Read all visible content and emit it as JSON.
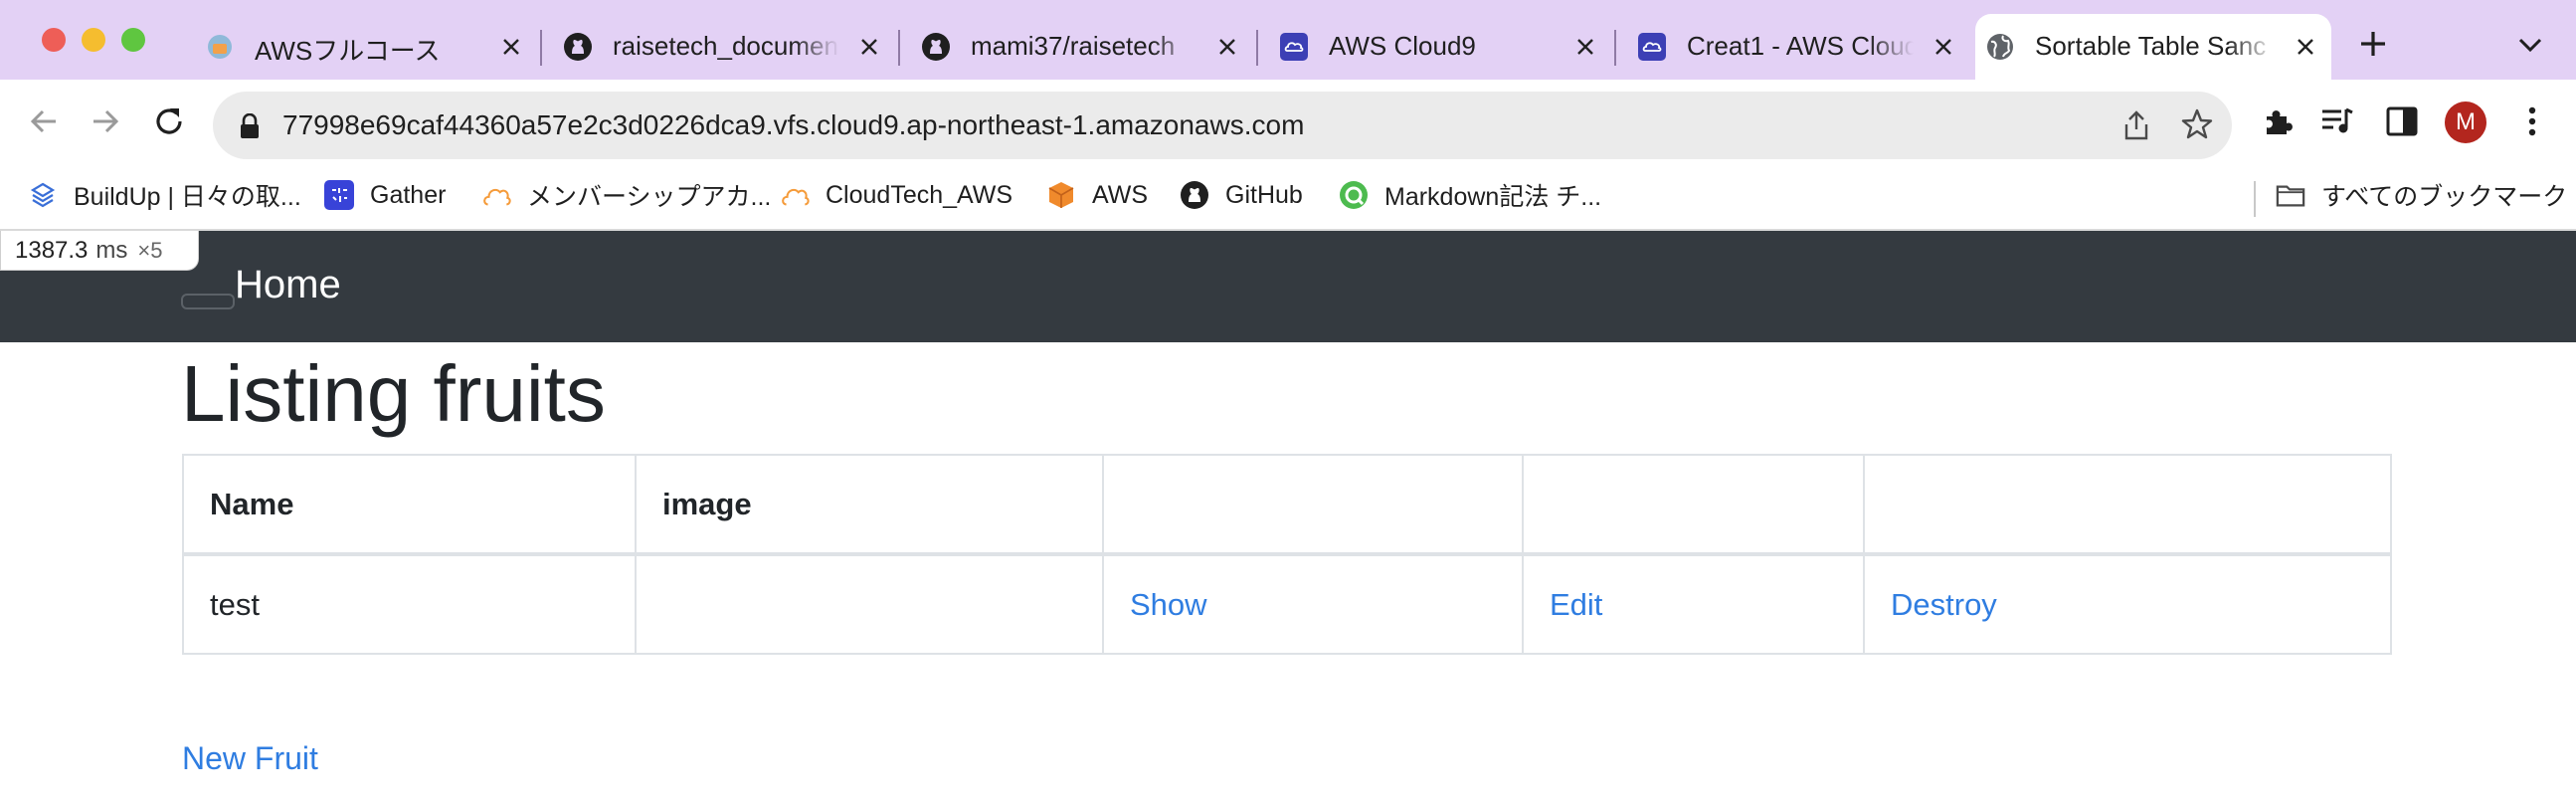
{
  "browser": {
    "tabs": [
      {
        "title": "AWSフルコース",
        "favicon": "aws-course-icon"
      },
      {
        "title": "raisetech_documen",
        "favicon": "github-icon"
      },
      {
        "title": "mami37/raisetech",
        "favicon": "github-icon"
      },
      {
        "title": "AWS Cloud9",
        "favicon": "cloud9-icon"
      },
      {
        "title": "Creat1 - AWS Cloud",
        "favicon": "cloud9-icon"
      },
      {
        "title": "Sortable Table Sanc",
        "favicon": "globe-icon",
        "active": true
      }
    ],
    "url": "77998e69caf44360a57e2c3d0226dca9.vfs.cloud9.ap-northeast-1.amazonaws.com",
    "avatar_letter": "M",
    "bookmarks": [
      {
        "label": "BuildUp | 日々の取...",
        "icon": "buildup-icon"
      },
      {
        "label": "Gather",
        "icon": "gather-icon"
      },
      {
        "label": "メンバーシップアカ...",
        "icon": "cloud-outline-icon"
      },
      {
        "label": "CloudTech_AWS",
        "icon": "cloud-outline-icon"
      },
      {
        "label": "AWS",
        "icon": "aws-cube-icon"
      },
      {
        "label": "GitHub",
        "icon": "github-icon"
      },
      {
        "label": "Markdown記法 チ...",
        "icon": "markdown-site-icon"
      }
    ],
    "all_bookmarks": "すべてのブックマーク",
    "colors": {
      "tabstrip": "#e3d1f5",
      "avatar": "#b3261e"
    }
  },
  "timing": {
    "value": "1387.3",
    "unit": "ms",
    "multiplier": "×5"
  },
  "page": {
    "nav": {
      "home": "Home"
    },
    "title": "Listing fruits",
    "table": {
      "headers": [
        "Name",
        "image",
        "",
        "",
        ""
      ],
      "rows": [
        {
          "name": "test",
          "image": "",
          "show": "Show",
          "edit": "Edit",
          "destroy": "Destroy"
        }
      ]
    },
    "new_link": "New Fruit",
    "colors": {
      "navbar": "#343a40",
      "link": "#2f7de1"
    }
  }
}
